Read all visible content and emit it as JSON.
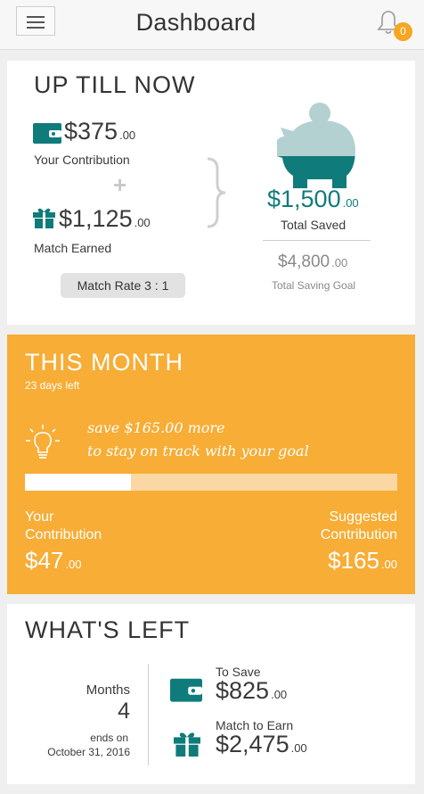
{
  "header": {
    "title": "Dashboard",
    "notification_count": "0"
  },
  "up_till_now": {
    "title": "UP TILL NOW",
    "contribution": {
      "dollars": "$375",
      "cents": ".00",
      "label": "Your Contribution"
    },
    "plus_sign": "+",
    "match": {
      "dollars": "$1,125",
      "cents": ".00",
      "label": "Match Earned"
    },
    "match_rate": "Match Rate 3 : 1",
    "total_saved": {
      "dollars": "$1,500",
      "cents": ".00",
      "label": "Total Saved"
    },
    "saving_goal": {
      "dollars": "$4,800",
      "cents": ".00",
      "label": "Total Saving Goal"
    }
  },
  "this_month": {
    "title": "THIS MONTH",
    "days_left": "23 days left",
    "tip_line1": "save $165.00 more",
    "tip_line2": "to stay on track with your goal",
    "progress_fraction": 0.2848,
    "your_label_1": "Your",
    "your_label_2": "Contribution",
    "your_amount": {
      "dollars": "$47",
      "cents": ".00"
    },
    "suggested_label_1": "Suggested",
    "suggested_label_2": "Contribution",
    "suggested_amount": {
      "dollars": "$165",
      "cents": ".00"
    }
  },
  "whats_left": {
    "title": "WHAT'S LEFT",
    "months_label": "Months",
    "months_value": "4",
    "ends_on_label": "ends on",
    "ends_on_date": "October 31, 2016",
    "to_save": {
      "label": "To Save",
      "dollars": "$825",
      "cents": ".00"
    },
    "match_to_earn": {
      "label": "Match to Earn",
      "dollars": "$2,475",
      "cents": ".00"
    }
  },
  "colors": {
    "teal": "#107b7b",
    "piggy_light": "#b3d1d1",
    "orange": "#f7ad36",
    "badge": "#f5a623"
  },
  "icons": [
    "menu-icon",
    "bell-icon",
    "wallet-icon",
    "gift-icon",
    "plus-icon",
    "brace-icon",
    "piggy-bank-icon",
    "lightbulb-icon"
  ]
}
